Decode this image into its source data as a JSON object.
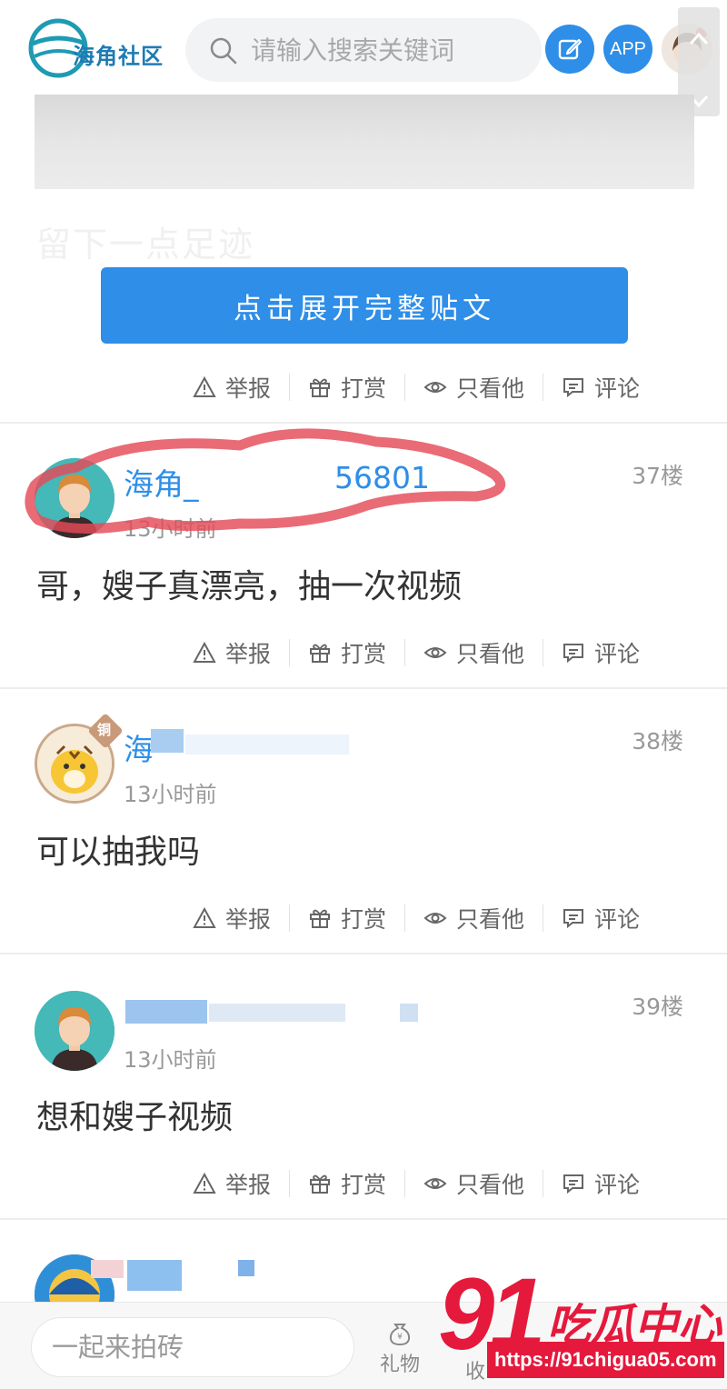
{
  "header": {
    "logo_text": "海角社区",
    "search_placeholder": "请输入搜索关键词",
    "app_label": "APP"
  },
  "post": {
    "faded_text": "留下一点足迹",
    "expand_label": "点击展开完整贴文"
  },
  "actions": {
    "report": "举报",
    "reward": "打赏",
    "only_him": "只看他",
    "comment": "评论"
  },
  "comments": [
    {
      "username": "海角_",
      "username_suffix": "56801",
      "time": "13小时前",
      "floor": "37楼",
      "content": "哥，嫂子真漂亮，抽一次视频"
    },
    {
      "username": "海",
      "badge": "铜",
      "time": "13小时前",
      "floor": "38楼",
      "content": "可以抽我吗"
    },
    {
      "username": "",
      "time": "13小时前",
      "floor": "39楼",
      "content": "想和嫂子视频"
    }
  ],
  "bottom_bar": {
    "brick_placeholder": "一起来拍砖",
    "gift_label": "礼物",
    "fav_label": "收"
  },
  "watermark": {
    "big": "91",
    "cn": "吃瓜中心",
    "url": "https://91chigua05.com"
  },
  "colors": {
    "accent": "#2e8ee8",
    "annotation": "#e5193c",
    "muted": "#999999"
  }
}
